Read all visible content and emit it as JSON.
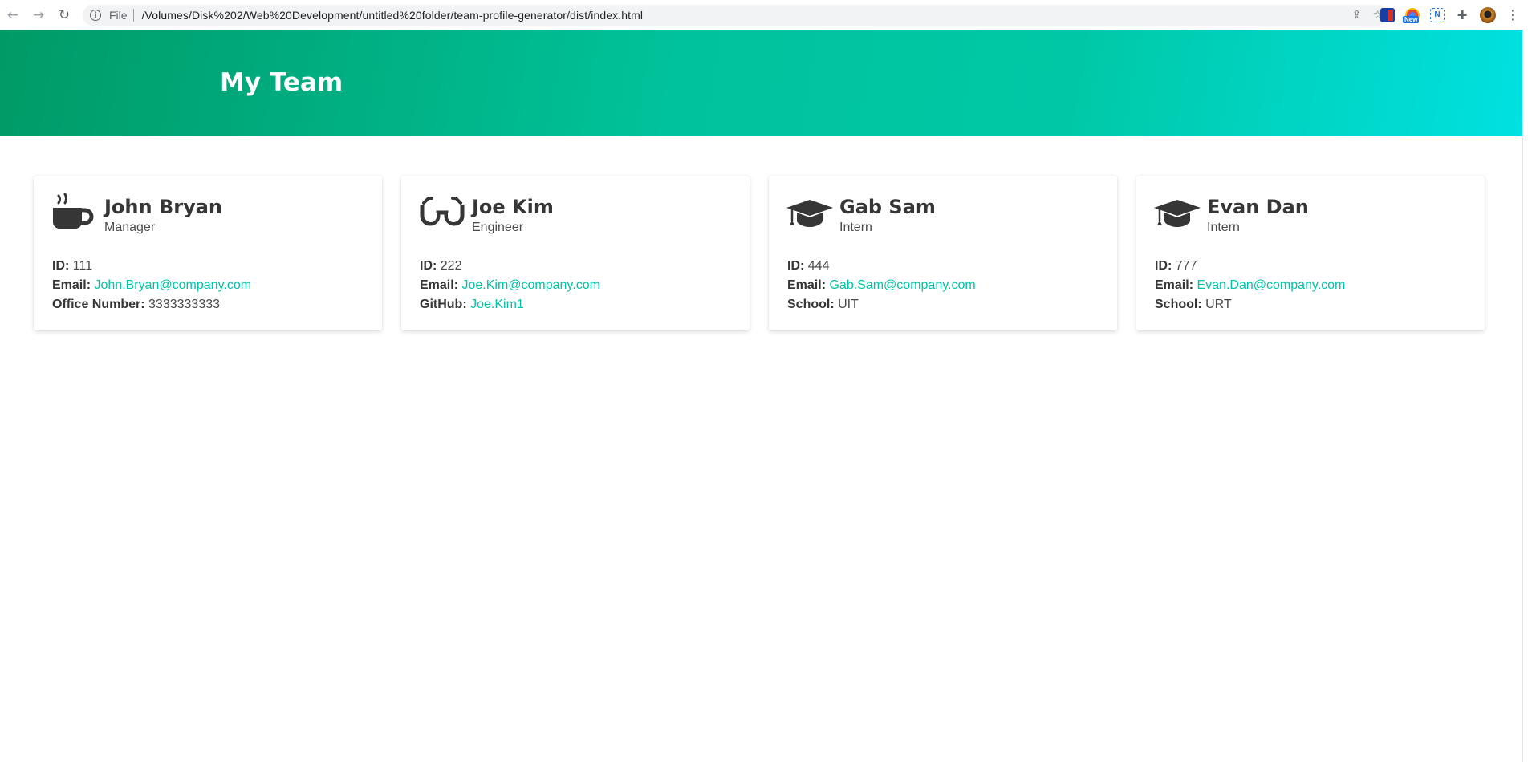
{
  "browser": {
    "file_label": "File",
    "url": "/Volumes/Disk%202/Web%20Development/untitled%20folder/team-profile-generator/dist/index.html",
    "badge_new": "New",
    "ext_c_label": "N"
  },
  "page": {
    "title": "My Team"
  },
  "labels": {
    "id": "ID:",
    "email": "Email:",
    "office": "Office Number:",
    "github": "GitHub:",
    "school": "School:"
  },
  "cards": [
    {
      "name": "John Bryan",
      "role": "Manager",
      "icon": "coffee-icon",
      "id": "111",
      "email": "John.Bryan@company.com",
      "office": "3333333333"
    },
    {
      "name": "Joe Kim",
      "role": "Engineer",
      "icon": "glasses-icon",
      "id": "222",
      "email": "Joe.Kim@company.com",
      "github": "Joe.Kim1"
    },
    {
      "name": "Gab Sam",
      "role": "Intern",
      "icon": "graduation-cap-icon",
      "id": "444",
      "email": "Gab.Sam@company.com",
      "school": "UIT"
    },
    {
      "name": "Evan Dan",
      "role": "Intern",
      "icon": "graduation-cap-icon",
      "id": "777",
      "email": "Evan.Dan@company.com",
      "school": "URT"
    }
  ],
  "colors": {
    "accent_link": "#00c4a7",
    "hero_start": "#009a66",
    "hero_end": "#00e1e1"
  }
}
